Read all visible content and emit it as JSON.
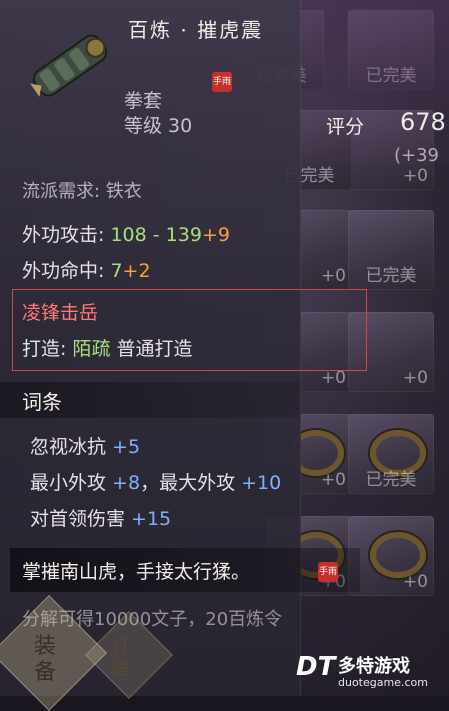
{
  "item": {
    "name": "百炼 · 摧虎震",
    "type": "拳套",
    "level": "等级 30",
    "score_label": "评分",
    "score_value": "678",
    "score_bonus": "(+39",
    "school_requirement": "流派需求: 铁衣"
  },
  "stats": {
    "attack_label": "外功攻击: ",
    "attack_range": "108 - 139",
    "attack_bonus": "+9",
    "hit_label": "外功命中: ",
    "hit_value": "7",
    "hit_bonus": "+2"
  },
  "set": {
    "name": "凌锋击岳",
    "forge_label": "打造: ",
    "forge_quality": "陌疏",
    "forge_type": "普通打造"
  },
  "affixes": {
    "title": "词条",
    "line1_label": "忽视冰抗 ",
    "line1_value": "+5",
    "line2_label_a": "最小外攻 ",
    "line2_value_a": "+8",
    "line2_label_b": "，最大外攻 ",
    "line2_value_b": "+10",
    "line3_label": "对首领伤害 ",
    "line3_value": "+15"
  },
  "description": "掌摧南山虎，手接太行猱。",
  "seal_text": "手雨",
  "salvage": "分解可得10000文子，20百炼令",
  "buttons": {
    "equip": "装备",
    "forge": "打造"
  },
  "inventory": {
    "completed_label": "已完美",
    "plus_zero": "+0"
  },
  "watermark": {
    "logo": "DT",
    "name": "多特游戏",
    "url": "duotegame.com"
  },
  "colors": {
    "green": "#a6e07d",
    "orange": "#f3a43c",
    "blue": "#7fb0ff",
    "set_red": "#ff7a7a"
  }
}
